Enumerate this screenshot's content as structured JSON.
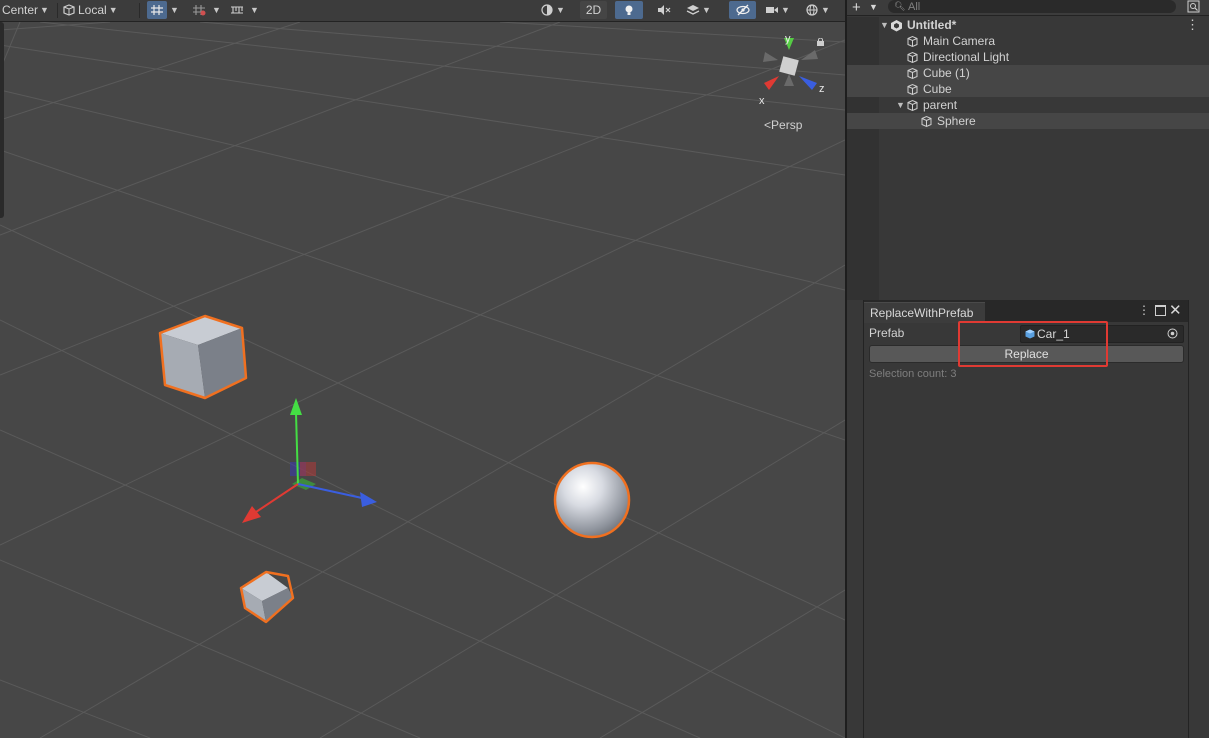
{
  "toolbar": {
    "pivot_label": "Center",
    "space_label": "Local",
    "mode_2d": "2D"
  },
  "scene": {
    "camera_label": "Persp",
    "axis_x": "x",
    "axis_y": "y",
    "axis_z": "z"
  },
  "hierarchy": {
    "search_placeholder": "All",
    "root": "Untitled*",
    "items": [
      "Main Camera",
      "Directional Light",
      "Cube (1)",
      "Cube",
      "parent",
      "Sphere"
    ]
  },
  "replace_window": {
    "tab_title": "ReplaceWithPrefab",
    "prefab_label": "Prefab",
    "prefab_value": "Car_1",
    "replace_label": "Replace",
    "selection_count": "Selection count: 3"
  },
  "colors": {
    "selection_outline": "#f07020",
    "highlight_box": "#e03a33",
    "active_tool": "#4d6a8f"
  }
}
